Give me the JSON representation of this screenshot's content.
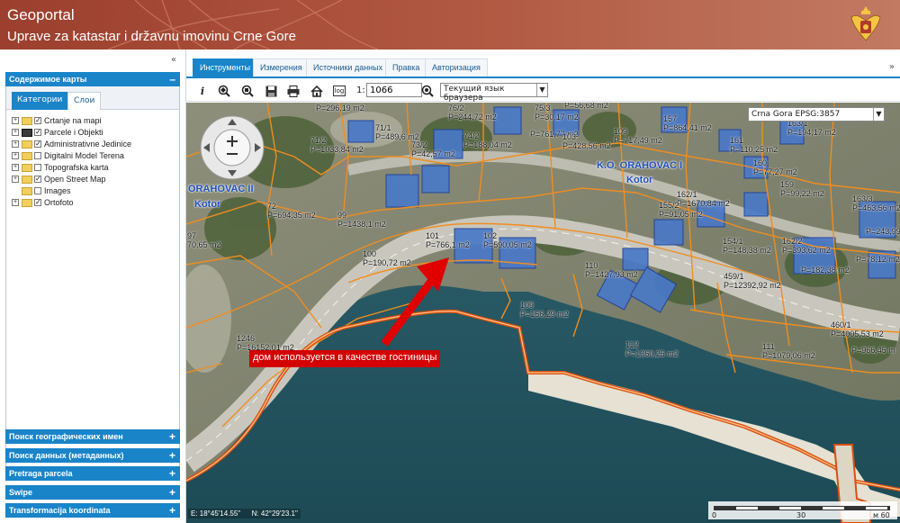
{
  "header": {
    "title": "Geoportal",
    "subtitle": "Uprave za katastar i državnu imovinu Crne Gore",
    "crest_icon": "montenegro-coat-of-arms-icon"
  },
  "sidebar": {
    "collapse_icon": "«",
    "map_content": {
      "title": "Содержимое карты",
      "toggle": "–",
      "tabs": [
        {
          "label": "Категории",
          "active": true
        },
        {
          "label": "Слои",
          "active": false
        }
      ],
      "layers": [
        {
          "label": "Crtanje na mapi",
          "checked": true,
          "expandable": true,
          "icon": "folder-icon"
        },
        {
          "label": "Parcele i Objekti",
          "checked": true,
          "expandable": true,
          "icon": "parcel-icon"
        },
        {
          "label": "Administrativne Jedinice",
          "checked": true,
          "expandable": true,
          "icon": "folder-icon"
        },
        {
          "label": "Digitalni Model Terena",
          "checked": false,
          "expandable": true,
          "icon": "folder-icon"
        },
        {
          "label": "Topografska karta",
          "checked": false,
          "expandable": true,
          "icon": "folder-icon"
        },
        {
          "label": "Open Street Map",
          "checked": true,
          "expandable": true,
          "icon": "folder-icon"
        },
        {
          "label": "Images",
          "checked": false,
          "expandable": false,
          "icon": "folder-icon"
        },
        {
          "label": "Ortofoto",
          "checked": true,
          "expandable": true,
          "icon": "folder-icon"
        }
      ]
    },
    "accordion": [
      {
        "label": "Поиск географических имен",
        "toggle": "+"
      },
      {
        "label": "Поиск данных (метаданных)",
        "toggle": "+"
      },
      {
        "label": "Pretraga parcela",
        "toggle": "+"
      },
      {
        "label": "Swipe",
        "toggle": "+"
      },
      {
        "label": "Transformacija koordinata",
        "toggle": "+"
      }
    ]
  },
  "main": {
    "tabs": [
      {
        "label": "Инструменты",
        "active": true
      },
      {
        "label": "Измерения",
        "active": false
      },
      {
        "label": "Источники данных",
        "active": false
      },
      {
        "label": "Правка",
        "active": false
      },
      {
        "label": "Авторизация",
        "active": false
      }
    ],
    "collapse_icon": "»",
    "toolbar": {
      "tools": [
        "info-icon",
        "zoom-extent-icon",
        "zoom-region-icon",
        "save-icon",
        "print-icon",
        "home-icon",
        "log-icon"
      ],
      "log_label": "log",
      "scale_prefix": "1:",
      "scale_value": "1066",
      "language_icon": "globe-icon",
      "language": "Текущий язык браузера"
    },
    "map": {
      "crs": "Crna Gora EPSG:3857",
      "callout": "дом используется в качестве гостиницы",
      "coord_e": "E: 18°45'14.55\"",
      "coord_n": "N: 42°29'23.1\"",
      "scale_ticks": [
        "0",
        "30",
        "м 60"
      ],
      "places": [
        {
          "label": "K.O. ORAHOVAC I"
        },
        {
          "label": "Kotor"
        },
        {
          "label": "ORAHOVAC II"
        },
        {
          "label": "Kotor"
        }
      ],
      "parcels": [
        {
          "num": "",
          "area": "P=296,19 m2"
        },
        {
          "num": "76/2",
          "area": "P=244,72 m2"
        },
        {
          "num": "75/3",
          "area": "P=30,17 m2"
        },
        {
          "num": "",
          "area": "P=56,68 m2"
        },
        {
          "num": "71/1",
          "area": "P=489,6 m2"
        },
        {
          "num": "74/2",
          "area": "P=188,04 m2"
        },
        {
          "num": "",
          "area": "P=761,77 m2"
        },
        {
          "num": "103",
          "area": "P=428,56 m2"
        },
        {
          "num": "71/2",
          "area": "P=1033,84 m2"
        },
        {
          "num": "73/2",
          "area": "P=42,57 m2"
        },
        {
          "num": "109",
          "area": "P=717,49 m2"
        },
        {
          "num": "157",
          "area": "P=864,41 m2"
        },
        {
          "num": "161",
          "area": "P=110,25 m2"
        },
        {
          "num": "163/1",
          "area": "P=194,17 m2"
        },
        {
          "num": "160",
          "area": "P=77,27 m2"
        },
        {
          "num": "159",
          "area": "P=99,22 m2"
        },
        {
          "num": "162/1",
          "area": "P=1670,84 m2"
        },
        {
          "num": "155/2",
          "area": "P=91,05 m2"
        },
        {
          "num": "163/3",
          "area": "P=463,56 m2"
        },
        {
          "num": "72",
          "area": "P=694,35 m2"
        },
        {
          "num": "99",
          "area": "P=1438,1 m2"
        },
        {
          "num": "101",
          "area": "P=766,1 m2"
        },
        {
          "num": "102",
          "area": "P=590,05 m2"
        },
        {
          "num": "100",
          "area": "P=190,72 m2"
        },
        {
          "num": "97",
          "area": "70,65 m2"
        },
        {
          "num": "154/1",
          "area": "P=148,38 m2"
        },
        {
          "num": "162/2",
          "area": "P=393,62 m2"
        },
        {
          "num": "",
          "area": "P=243,99"
        },
        {
          "num": "",
          "area": "P=78,12 m2"
        },
        {
          "num": "",
          "area": "P=182,38 m2"
        },
        {
          "num": "110",
          "area": "P=1427,93 m2"
        },
        {
          "num": "459/1",
          "area": "P=12392,92 m2"
        },
        {
          "num": "109",
          "area": "P=156,29 m2"
        },
        {
          "num": "460/1",
          "area": "P=4005,53 m2"
        },
        {
          "num": "112",
          "area": "P=1360,25 m2"
        },
        {
          "num": "111",
          "area": "P=1079,06 m2"
        },
        {
          "num": "",
          "area": "P=966,45 m"
        },
        {
          "num": "1246",
          "area": "P=16152,01 m2"
        }
      ]
    }
  }
}
